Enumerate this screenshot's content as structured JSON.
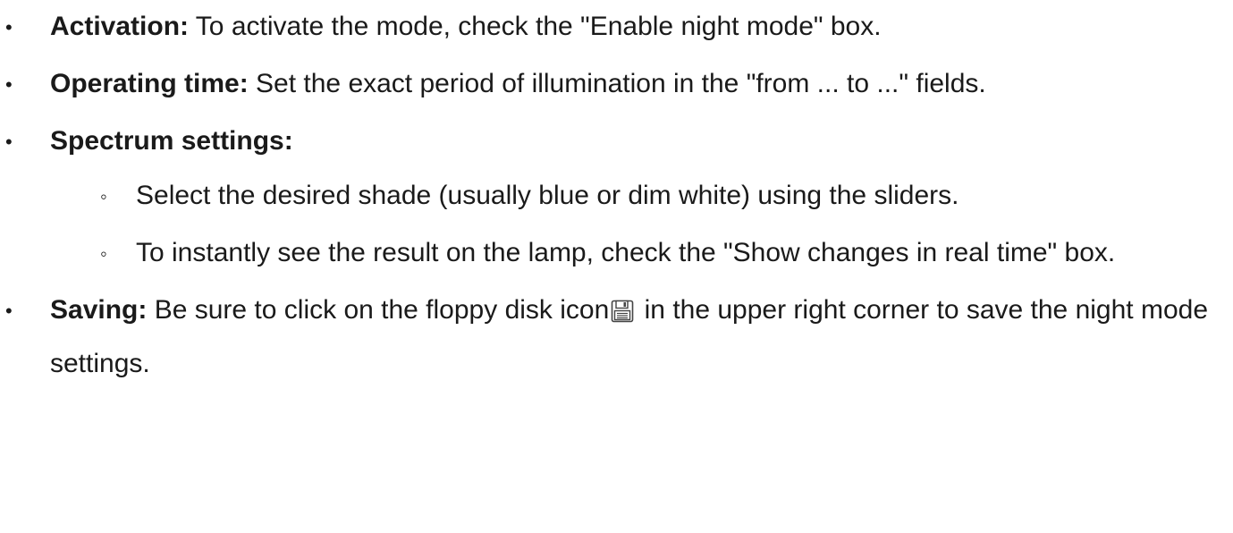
{
  "items": [
    {
      "lead": "Activation:",
      "text": " To activate the mode, check the \"Enable night mode\" box."
    },
    {
      "lead": "Operating time:",
      "text": " Set the exact period of illumination in the \"from ... to ...\" fields."
    },
    {
      "lead": "Spectrum settings:",
      "subitems": [
        "Select the desired shade (usually blue or dim white) using the sliders.",
        "To instantly see the result on the lamp, check the \"Show changes in real time\" box."
      ]
    },
    {
      "lead": "Saving:",
      "text_before_icon": " Be sure to click on the floppy disk icon",
      "icon": "floppy-disk-icon",
      "text_after_icon": " in the upper right corner to save the night mode settings."
    }
  ],
  "bullets": {
    "level1": "•",
    "level2": "◦"
  }
}
